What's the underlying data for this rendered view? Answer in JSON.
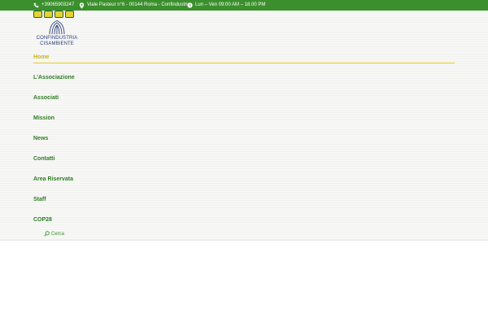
{
  "topbar": {
    "phone": "+39065903247",
    "address": "Viale Pasteur n°6 - 00144 Roma - Confindustria",
    "hours": "Lun – Ven 09:00 AM – 18.00 PM"
  },
  "logo": {
    "line1": "CONFINDUSTRIA",
    "line2": "CISAMBIENTE"
  },
  "nav": {
    "items": [
      {
        "label": "Home",
        "active": true
      },
      {
        "label": "L'Associazione"
      },
      {
        "label": "Associati"
      },
      {
        "label": "Mission"
      },
      {
        "label": "News"
      },
      {
        "label": "Contatti"
      },
      {
        "label": "Area Riservata"
      },
      {
        "label": "Staff"
      },
      {
        "label": "COP28"
      }
    ]
  },
  "search": {
    "label": "Cerca"
  },
  "colors": {
    "topbar_bg": "#3b8f2c",
    "nav_text": "#2f7d23",
    "active": "#c9b516"
  }
}
